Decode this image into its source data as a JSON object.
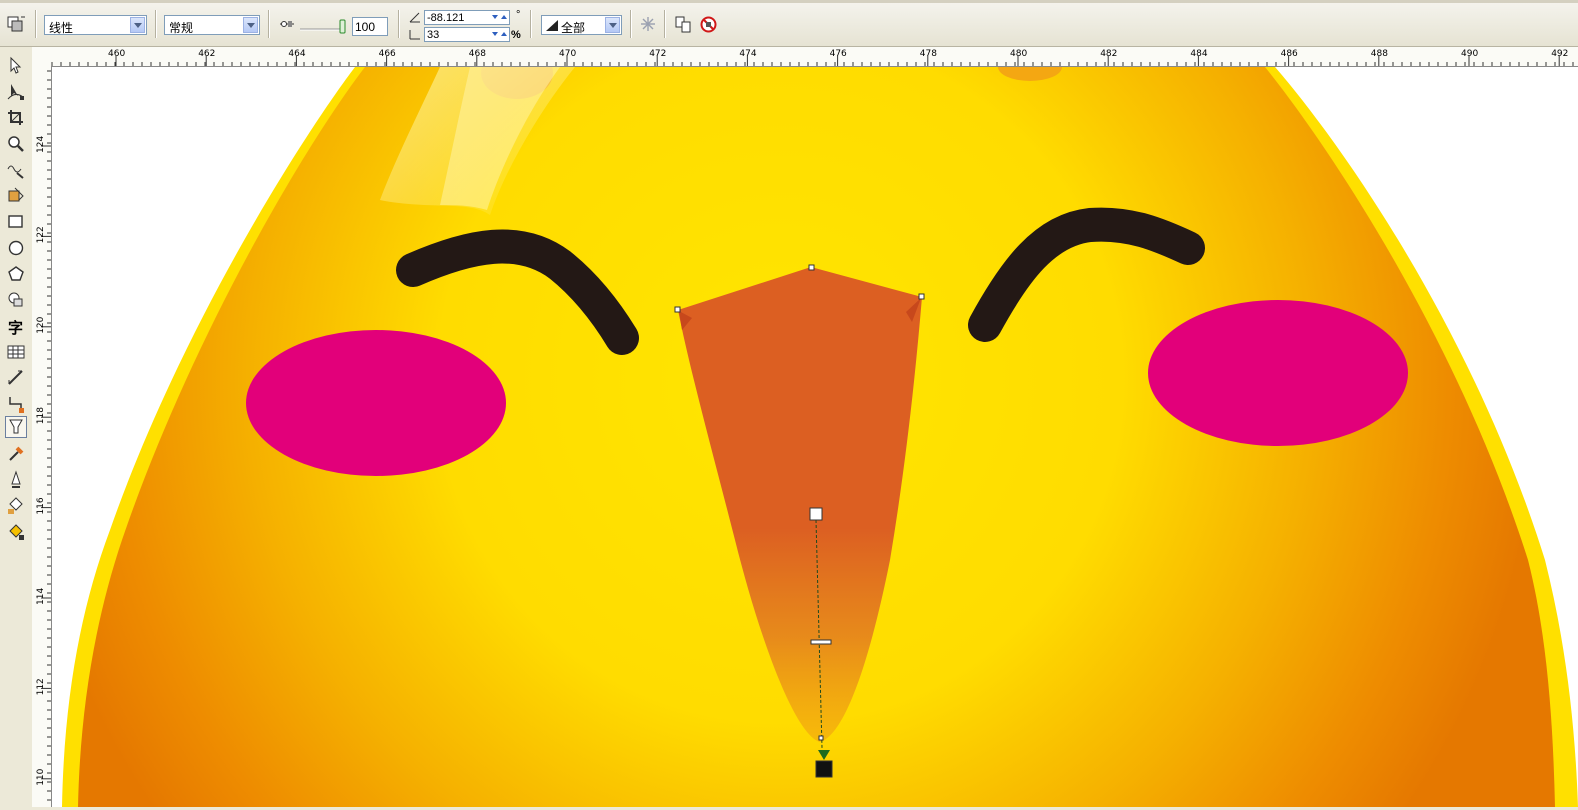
{
  "property_bar": {
    "fill_type": "线性",
    "blend_mode": "常规",
    "transparency_value": "100",
    "angle": "-88.121",
    "angle_unit": "°",
    "edge_pad": "33",
    "edge_pad_unit": "%",
    "apply_target": "全部"
  },
  "toolbox": {
    "text_tool_glyph": "字",
    "tools": [
      "pick-tool",
      "shape-tool",
      "crop-tool",
      "zoom-tool",
      "freehand-tool",
      "smart-fill-tool",
      "rectangle-tool",
      "ellipse-tool",
      "polygon-tool",
      "basic-shapes-tool",
      "text-tool",
      "table-tool",
      "dimension-tool",
      "connector-tool",
      "interactive-transparency-tool",
      "eyedropper-tool",
      "outline-tool",
      "fill-tool",
      "interactive-fill-tool"
    ],
    "active_tool": "interactive-transparency-tool"
  },
  "ruler_horizontal": {
    "labels": [
      "460",
      "462",
      "464",
      "466",
      "468",
      "470",
      "472",
      "474",
      "476",
      "478",
      "480",
      "482",
      "484",
      "486",
      "488",
      "490",
      "492"
    ]
  },
  "ruler_vertical": {
    "labels": [
      "124",
      "122",
      "120",
      "118",
      "116",
      "114",
      "112",
      "110"
    ]
  },
  "colors": {
    "face_yellow": "#ffe100",
    "face_orange": "#f08a00",
    "cheek_pink": "#e2007a",
    "brow_dark": "#231815",
    "beak_orange": "#dc5f22",
    "handle_green": "#1e6b1e"
  }
}
